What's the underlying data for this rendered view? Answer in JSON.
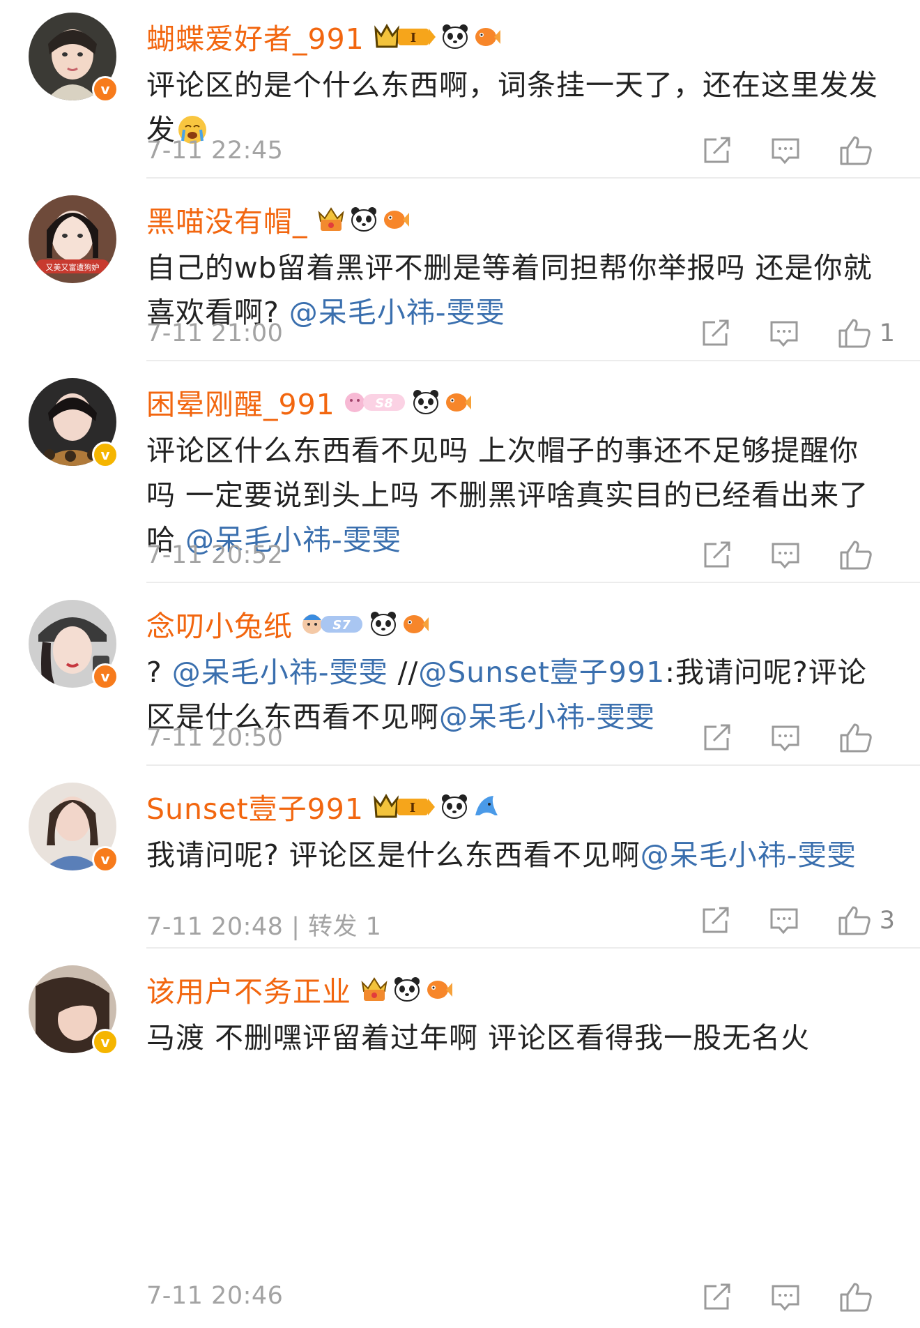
{
  "comments": [
    {
      "username": "蝴蝶爱好者_991",
      "level": "I",
      "text_parts": [
        {
          "t": "评论区的是个什么东西啊，词条挂一天了，还在这里发发发",
          "mention": false
        }
      ],
      "emoji": "crying-face-emoji",
      "time": "7-11 22:45",
      "repost": "",
      "likes": "",
      "verify": "orange"
    },
    {
      "username": "黑喵没有帽_",
      "level": "",
      "avatar_tag": "又美又富遭狗妒",
      "text_parts": [
        {
          "t": "自己的wb留着黑评不删是等着同担帮你举报吗 还是你就喜欢看啊? ",
          "mention": false
        },
        {
          "t": "@呆毛小祎-雯雯",
          "mention": true
        }
      ],
      "time": "7-11 21:00",
      "repost": "",
      "likes": "1",
      "verify": ""
    },
    {
      "username": "困晕刚醒_991",
      "level": "S8",
      "text_parts": [
        {
          "t": "评论区什么东西看不见吗 上次帽子的事还不足够提醒你吗 一定要说到头上吗 不删黑评啥真实目的已经看出来了哈 ",
          "mention": false
        },
        {
          "t": "@呆毛小祎-雯雯",
          "mention": true
        }
      ],
      "time": "7-11 20:52",
      "repost": "",
      "likes": "",
      "verify": "gold"
    },
    {
      "username": "念叨小兔纸",
      "level": "S7",
      "text_parts": [
        {
          "t": "? ",
          "mention": false
        },
        {
          "t": "@呆毛小祎-雯雯",
          "mention": true
        },
        {
          "t": " //",
          "mention": false
        },
        {
          "t": "@Sunset壹子991",
          "mention": true
        },
        {
          "t": ":我请问呢?评论区是什么东西看不见啊",
          "mention": false
        },
        {
          "t": "@呆毛小祎-雯雯",
          "mention": true
        }
      ],
      "time": "7-11 20:50",
      "repost": "",
      "likes": "",
      "verify": "orange"
    },
    {
      "username": "Sunset壹子991",
      "level": "I",
      "text_parts": [
        {
          "t": "我请问呢? 评论区是什么东西看不见啊",
          "mention": false
        },
        {
          "t": "@呆毛小祎-雯雯",
          "mention": true
        }
      ],
      "time": "7-11 20:48",
      "repost": " | 转发 1",
      "likes": "3",
      "verify": "orange"
    },
    {
      "username": "该用户不务正业",
      "level": "",
      "text_parts": [
        {
          "t": "马渡 不删嘿评留着过年啊 评论区看得我一股无名火",
          "mention": false
        }
      ],
      "time": "7-11 20:46",
      "repost": "",
      "likes": "",
      "verify": "gold"
    }
  ],
  "verify_glyph": "v",
  "colors": {
    "username": "#f2660f",
    "mention": "#3a6fae",
    "meta": "#a3a3a3",
    "icon": "#9a9a9a",
    "divider": "#ececec"
  },
  "icons": {
    "repost": "share-external-icon",
    "comment": "comment-bubble-icon",
    "like": "thumbs-up-icon",
    "badge_panda": "panda-icon",
    "badge_fish": "goldfish-icon"
  }
}
